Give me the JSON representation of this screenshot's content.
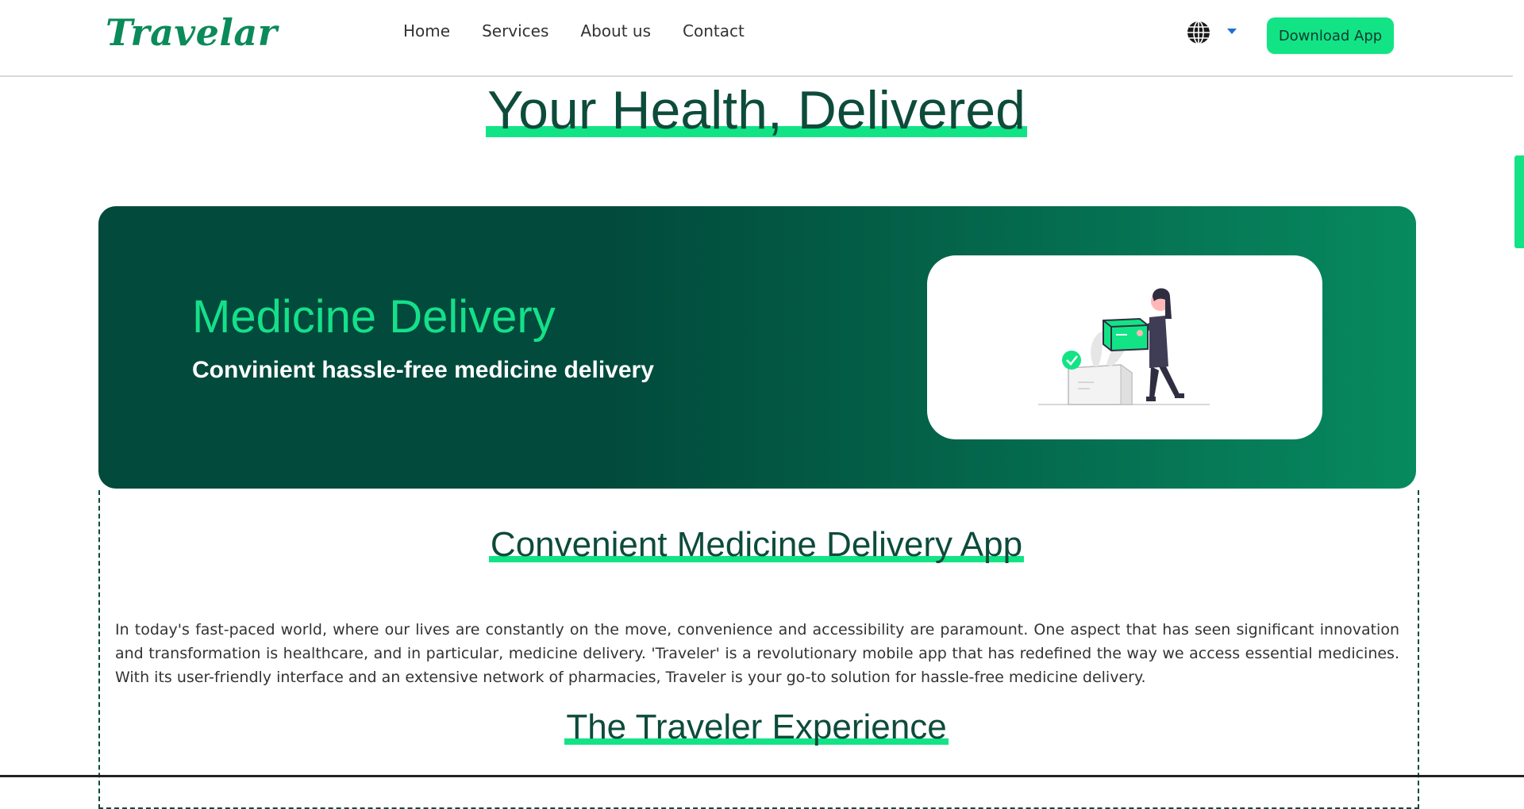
{
  "header": {
    "logo": "Travelar",
    "nav": [
      "Home",
      "Services",
      "About us",
      "Contact"
    ],
    "language_icon": "globe-icon",
    "download_label": "Download App"
  },
  "page": {
    "title": "Your Health, Delivered"
  },
  "hero": {
    "title": "Medicine Delivery",
    "subtitle": "Convinient hassle-free medicine delivery",
    "illustration": "delivery-woman-illustration"
  },
  "content": {
    "heading": "Convenient Medicine Delivery App",
    "paragraph": "In today's fast-paced world, where our lives are constantly on the move, convenience and accessibility are paramount. One aspect that has seen significant innovation and transformation is healthcare, and in particular, medicine delivery. 'Traveler' is a revolutionary mobile app that has redefined the way we access essential medicines. With its user-friendly interface and an extensive network of pharmacies, Traveler is your go-to solution for hassle-free medicine delivery.",
    "subheading": "The Traveler Experience"
  },
  "colors": {
    "accent": "#12e486",
    "dark_green": "#0d4b3b",
    "hero_start": "#024a3c",
    "hero_end": "#078a5e"
  }
}
